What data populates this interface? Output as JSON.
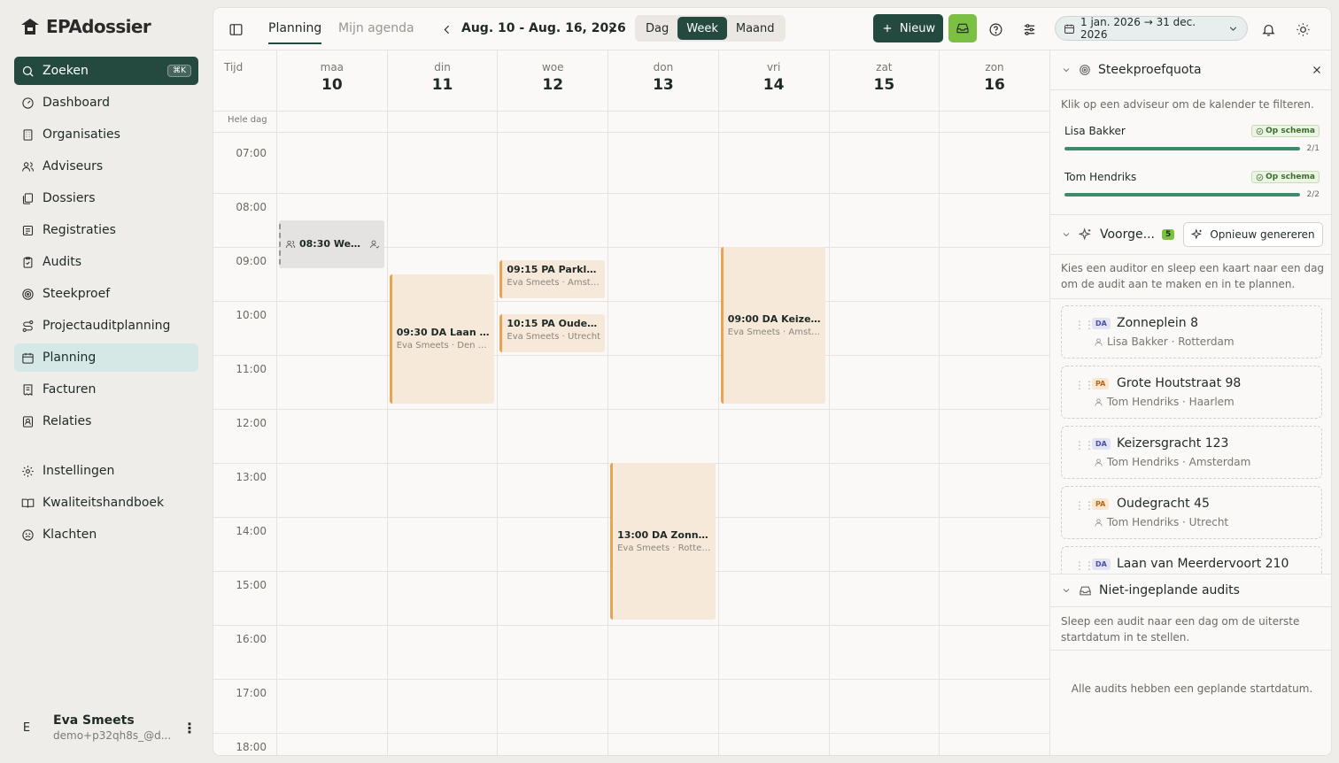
{
  "app": {
    "logo_text": "EPAdossier"
  },
  "sidebar": {
    "search": {
      "label": "Zoeken",
      "shortcut": "⌘K"
    },
    "items": [
      {
        "label": "Dashboard",
        "icon": "dashboard-icon"
      },
      {
        "label": "Organisaties",
        "icon": "building-icon"
      },
      {
        "label": "Adviseurs",
        "icon": "users-icon"
      },
      {
        "label": "Dossiers",
        "icon": "files-icon"
      },
      {
        "label": "Registraties",
        "icon": "registration-icon"
      },
      {
        "label": "Audits",
        "icon": "clipboard-icon"
      },
      {
        "label": "Steekproef",
        "icon": "target-icon"
      },
      {
        "label": "Projectauditplanning",
        "icon": "route-icon"
      },
      {
        "label": "Planning",
        "icon": "calendar-icon",
        "active": true
      },
      {
        "label": "Facturen",
        "icon": "invoice-icon"
      },
      {
        "label": "Relaties",
        "icon": "contacts-icon"
      }
    ],
    "bottom_items": [
      {
        "label": "Instellingen",
        "icon": "gear-icon"
      },
      {
        "label": "Kwaliteitshandboek",
        "icon": "book-icon"
      },
      {
        "label": "Klachten",
        "icon": "frown-icon"
      }
    ],
    "user": {
      "initial": "E",
      "name": "Eva Smeets",
      "email": "demo+p32qh8s_@d..."
    }
  },
  "toolbar": {
    "tabs": [
      "Planning",
      "Mijn agenda"
    ],
    "range_label": "Aug. 10 - Aug. 16, 2026",
    "views": [
      "Dag",
      "Week",
      "Maand"
    ],
    "active_view": "Week",
    "new_label": "Nieuw",
    "date_range": "1 jan. 2026 → 31 dec. 2026"
  },
  "calendar": {
    "time_label": "Tijd",
    "all_day_label": "Hele dag",
    "days": [
      {
        "name": "maa",
        "num": "10"
      },
      {
        "name": "din",
        "num": "11"
      },
      {
        "name": "woe",
        "num": "12"
      },
      {
        "name": "don",
        "num": "13"
      },
      {
        "name": "vri",
        "num": "14"
      },
      {
        "name": "zat",
        "num": "15"
      },
      {
        "name": "zon",
        "num": "16"
      }
    ],
    "hours": [
      "07:00",
      "08:00",
      "09:00",
      "10:00",
      "11:00",
      "12:00",
      "13:00",
      "14:00",
      "15:00",
      "16:00",
      "17:00",
      "18:00"
    ],
    "events": [
      {
        "day": 0,
        "start": 8.5,
        "end": 9.4,
        "kind": "meeting",
        "title": "08:30 Week...",
        "sub": ""
      },
      {
        "day": 1,
        "start": 9.5,
        "end": 11.9,
        "kind": "audit",
        "title": "09:30 DA Laan va...",
        "sub": "Eva Smeets · Den H..."
      },
      {
        "day": 2,
        "start": 9.25,
        "end": 9.95,
        "kind": "audit",
        "title": "09:15 PA Parklaan...",
        "sub": "Eva Smeets · Amste..."
      },
      {
        "day": 2,
        "start": 10.25,
        "end": 10.95,
        "kind": "audit",
        "title": "10:15 PA Oudegra...",
        "sub": "Eva Smeets · Utrecht"
      },
      {
        "day": 3,
        "start": 13.0,
        "end": 15.9,
        "kind": "audit",
        "title": "13:00 DA Zonnepl...",
        "sub": "Eva Smeets · Rotter..."
      },
      {
        "day": 4,
        "start": 9.0,
        "end": 11.9,
        "kind": "audit",
        "title": "09:00 DA Keizers...",
        "sub": "Eva Smeets · Amste..."
      }
    ]
  },
  "panel": {
    "quota": {
      "title": "Steekproefquota",
      "desc": "Klik op een adviseur om de kalender te filteren.",
      "rows": [
        {
          "name": "Lisa Bakker",
          "status": "Op schema",
          "count": "2/1",
          "progress": 1.0
        },
        {
          "name": "Tom Hendriks",
          "status": "Op schema",
          "count": "2/2",
          "progress": 1.0
        }
      ]
    },
    "suggestions": {
      "title": "Voorge...",
      "count": "5",
      "regen_label": "Opnieuw genereren",
      "desc": "Kies een auditor en sleep een kaart naar een dag om de audit aan te maken en in te plannen.",
      "cards": [
        {
          "type": "DA",
          "title": "Zonneplein 8",
          "sub": "Lisa Bakker · Rotterdam"
        },
        {
          "type": "PA",
          "title": "Grote Houtstraat 98",
          "sub": "Tom Hendriks · Haarlem"
        },
        {
          "type": "DA",
          "title": "Keizersgracht 123",
          "sub": "Tom Hendriks · Amsterdam"
        },
        {
          "type": "PA",
          "title": "Oudegracht 45",
          "sub": "Tom Hendriks · Utrecht"
        },
        {
          "type": "DA",
          "title": "Laan van Meerdervoort 210",
          "sub": ""
        }
      ]
    },
    "unplanned": {
      "title": "Niet-ingeplande audits",
      "desc": "Sleep een audit naar een dag om de uiterste startdatum in te stellen.",
      "empty": "Alle audits hebben een geplande startdatum."
    }
  },
  "colors": {
    "brand": "#24493f",
    "accent_green": "#7bc043",
    "event_bg": "#f6e9da",
    "event_border": "#e6a352"
  }
}
